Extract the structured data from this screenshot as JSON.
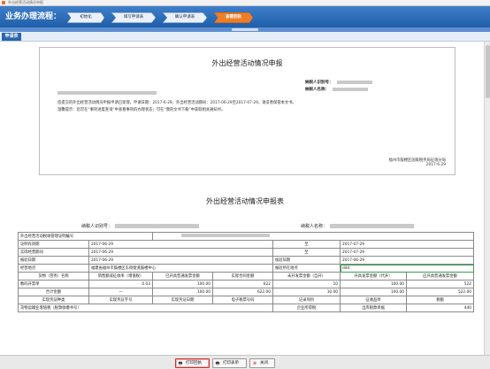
{
  "window": {
    "title": "外出经营活动情况申报"
  },
  "flow": {
    "label": "业务办理流程：",
    "steps": [
      {
        "label": "初始化",
        "active": false
      },
      {
        "label": "填写申请表",
        "active": false
      },
      {
        "label": "确认申请表",
        "active": false
      },
      {
        "label": "查看回执",
        "active": true
      }
    ]
  },
  "subtab": {
    "label": "申请表"
  },
  "notice": {
    "title": "外出经营活动情况申报",
    "taxpayer_id_label": "纳税人识别号：",
    "taxpayer_name_label": "纳税人名称：",
    "body_line1": "您提交的外出经营活动情况申报申请已受理，申请日期：2017-6-29，外出经营活动期间：2017-06-29至2017-07-29，请妥善保管本文书。",
    "body_line2": "温馨提示：您可在“事项进度查询”中查看事项的办理状态；可在“我的文书下载”中获取相关通知书。",
    "authority": "福州市鼓楼区国家税务局征收分局",
    "date": "2017-6-29"
  },
  "report": {
    "title": "外出经营活动情况申报表",
    "taxpayer_id_label": "纳税人识别号：",
    "taxpayer_name_label": "纳税人名称：",
    "rows": {
      "cert_no_label": "外出经营活动税收管理证明编号",
      "period_label": "证明有效期",
      "period_from": "2017-06-29",
      "to_label": "至",
      "period_to": "2017-07-29",
      "actual_label": "实际经营期间",
      "actual_from": "2017-06-29",
      "actual_to": "2017-07-29",
      "report_date_label": "报验日期",
      "report_date": "2017-06-29",
      "verify_date_label": "核验日期",
      "verify_date": "2017-06-29",
      "location_label": "经营地点",
      "location": "福建省福州市鼓楼区东街街道鼓楼中心",
      "report_location_label": "报验所在地点",
      "report_location": "ddd"
    },
    "sales_headers": [
      "货物（劳务）名称",
      "销售额或征收率（增值税）",
      "已开具普通发票金额",
      "实际合同金额",
      "未开发票金额（自开）",
      "开具发票金额（代开）",
      "应开具普通发票金额"
    ],
    "sales_rows": [
      {
        "name": "数码开票单",
        "rate": "0.03",
        "invoiced": "100.00",
        "contract": "622",
        "uninvoiced": "10",
        "issued": "100.00",
        "due": "522"
      },
      {
        "name": "合计金额",
        "rate": "—",
        "invoiced": "100.00",
        "contract": "622.00",
        "uninvoiced": "10.00",
        "issued": "100.00",
        "due": "522.00"
      }
    ],
    "voucher_headers": [
      "实现凭证种类",
      "实现凭证字号",
      "实现凭证日期",
      "电子税票号码",
      "记录项目",
      "征收品目",
      "税额"
    ],
    "bottom_row": {
      "label": "货物运输业增值税（税款收缴书号）",
      "receipt_label": "企业所得税",
      "code_label": "出库税款单据",
      "amount": "440"
    }
  },
  "buttons": {
    "print_receipt": "打印回执",
    "print_form": "打印表单",
    "close": "关闭"
  }
}
